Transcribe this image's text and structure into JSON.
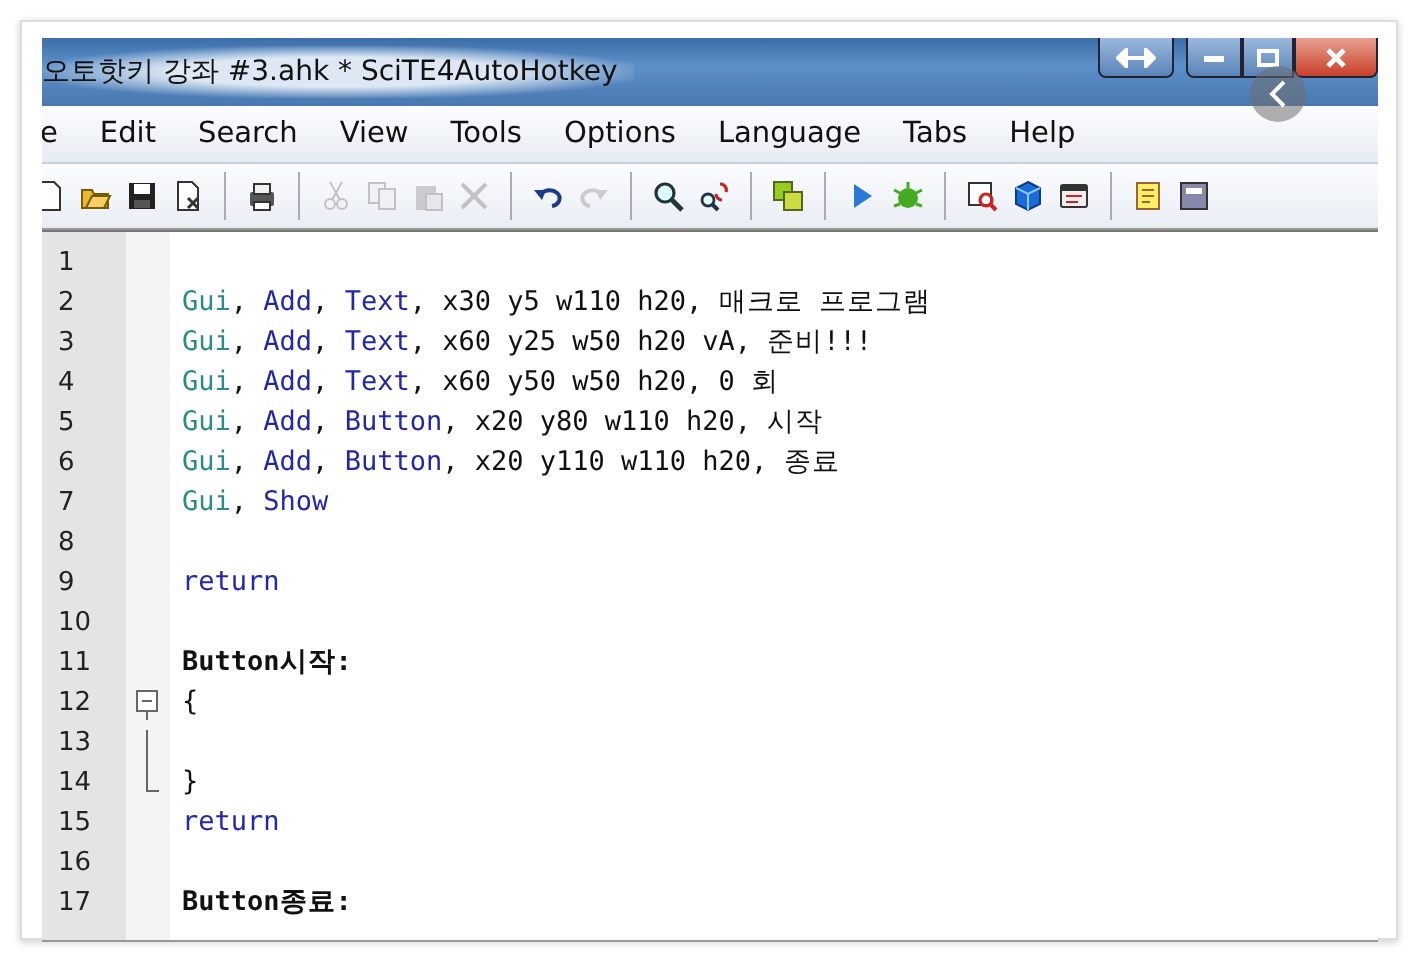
{
  "window": {
    "title": "오토핫키 강좌 #3.ahk * SciTE4AutoHotkey"
  },
  "menu": [
    {
      "label": "e"
    },
    {
      "label": "Edit"
    },
    {
      "label": "Search"
    },
    {
      "label": "View"
    },
    {
      "label": "Tools"
    },
    {
      "label": "Options"
    },
    {
      "label": "Language"
    },
    {
      "label": "Tabs"
    },
    {
      "label": "Help"
    }
  ],
  "toolbar": [
    {
      "kind": "new",
      "disabled": false
    },
    {
      "kind": "open",
      "disabled": false
    },
    {
      "kind": "save",
      "disabled": false
    },
    {
      "kind": "close",
      "disabled": false
    },
    {
      "kind": "separator"
    },
    {
      "kind": "print",
      "disabled": false
    },
    {
      "kind": "separator"
    },
    {
      "kind": "cut",
      "disabled": true
    },
    {
      "kind": "copy",
      "disabled": true
    },
    {
      "kind": "paste",
      "disabled": true
    },
    {
      "kind": "delete",
      "disabled": true
    },
    {
      "kind": "separator"
    },
    {
      "kind": "undo",
      "disabled": false
    },
    {
      "kind": "redo",
      "disabled": true
    },
    {
      "kind": "separator"
    },
    {
      "kind": "find",
      "disabled": false
    },
    {
      "kind": "replace",
      "disabled": false
    },
    {
      "kind": "separator"
    },
    {
      "kind": "compile",
      "disabled": false
    },
    {
      "kind": "separator"
    },
    {
      "kind": "run",
      "disabled": false
    },
    {
      "kind": "debug",
      "disabled": false
    },
    {
      "kind": "separator"
    },
    {
      "kind": "inspect",
      "disabled": false
    },
    {
      "kind": "cube",
      "disabled": false
    },
    {
      "kind": "window",
      "disabled": false
    },
    {
      "kind": "separator"
    },
    {
      "kind": "note",
      "disabled": false
    },
    {
      "kind": "panel",
      "disabled": false
    }
  ],
  "editor": {
    "lines": [
      {
        "number": "1"
      },
      {
        "number": "2",
        "tokens": [
          {
            "kind": "command",
            "text": "Gui"
          },
          {
            "kind": "plain",
            "text": ", "
          },
          {
            "kind": "keyword",
            "text": "Add"
          },
          {
            "kind": "plain",
            "text": ", "
          },
          {
            "kind": "keyword",
            "text": "Text"
          },
          {
            "kind": "plain",
            "text": ", x30 y5 w110 h20, 매크로 프로그램"
          }
        ]
      },
      {
        "number": "3",
        "tokens": [
          {
            "kind": "command",
            "text": "Gui"
          },
          {
            "kind": "plain",
            "text": ", "
          },
          {
            "kind": "keyword",
            "text": "Add"
          },
          {
            "kind": "plain",
            "text": ", "
          },
          {
            "kind": "keyword",
            "text": "Text"
          },
          {
            "kind": "plain",
            "text": ", x60 y25 w50 h20 vA, 준비!!!"
          }
        ]
      },
      {
        "number": "4",
        "tokens": [
          {
            "kind": "command",
            "text": "Gui"
          },
          {
            "kind": "plain",
            "text": ", "
          },
          {
            "kind": "keyword",
            "text": "Add"
          },
          {
            "kind": "plain",
            "text": ", "
          },
          {
            "kind": "keyword",
            "text": "Text"
          },
          {
            "kind": "plain",
            "text": ", x60 y50 w50 h20, 0 회"
          }
        ]
      },
      {
        "number": "5",
        "tokens": [
          {
            "kind": "command",
            "text": "Gui"
          },
          {
            "kind": "plain",
            "text": ", "
          },
          {
            "kind": "keyword",
            "text": "Add"
          },
          {
            "kind": "plain",
            "text": ", "
          },
          {
            "kind": "keyword",
            "text": "Button"
          },
          {
            "kind": "plain",
            "text": ", x20 y80 w110 h20, 시작"
          }
        ]
      },
      {
        "number": "6",
        "tokens": [
          {
            "kind": "command",
            "text": "Gui"
          },
          {
            "kind": "plain",
            "text": ", "
          },
          {
            "kind": "keyword",
            "text": "Add"
          },
          {
            "kind": "plain",
            "text": ", "
          },
          {
            "kind": "keyword",
            "text": "Button"
          },
          {
            "kind": "plain",
            "text": ", x20 y110 w110 h20, 종료"
          }
        ]
      },
      {
        "number": "7",
        "tokens": [
          {
            "kind": "command",
            "text": "Gui"
          },
          {
            "kind": "plain",
            "text": ", "
          },
          {
            "kind": "keyword",
            "text": "Show"
          }
        ]
      },
      {
        "number": "8"
      },
      {
        "number": "9",
        "tokens": [
          {
            "kind": "keyword",
            "text": "return"
          }
        ]
      },
      {
        "number": "10"
      },
      {
        "number": "11",
        "tokens": [
          {
            "kind": "label",
            "text": "Button시작:"
          }
        ]
      },
      {
        "number": "12",
        "kind": "fold-start",
        "tokens": [
          {
            "kind": "plain",
            "text": "{"
          }
        ]
      },
      {
        "number": "13",
        "kind": "fold-body"
      },
      {
        "number": "14",
        "kind": "fold-end",
        "tokens": [
          {
            "kind": "plain",
            "text": "}"
          }
        ]
      },
      {
        "number": "15",
        "tokens": [
          {
            "kind": "keyword",
            "text": "return"
          }
        ]
      },
      {
        "number": "16"
      },
      {
        "number": "17",
        "tokens": [
          {
            "kind": "label",
            "text": "Button종료:"
          }
        ]
      }
    ]
  }
}
